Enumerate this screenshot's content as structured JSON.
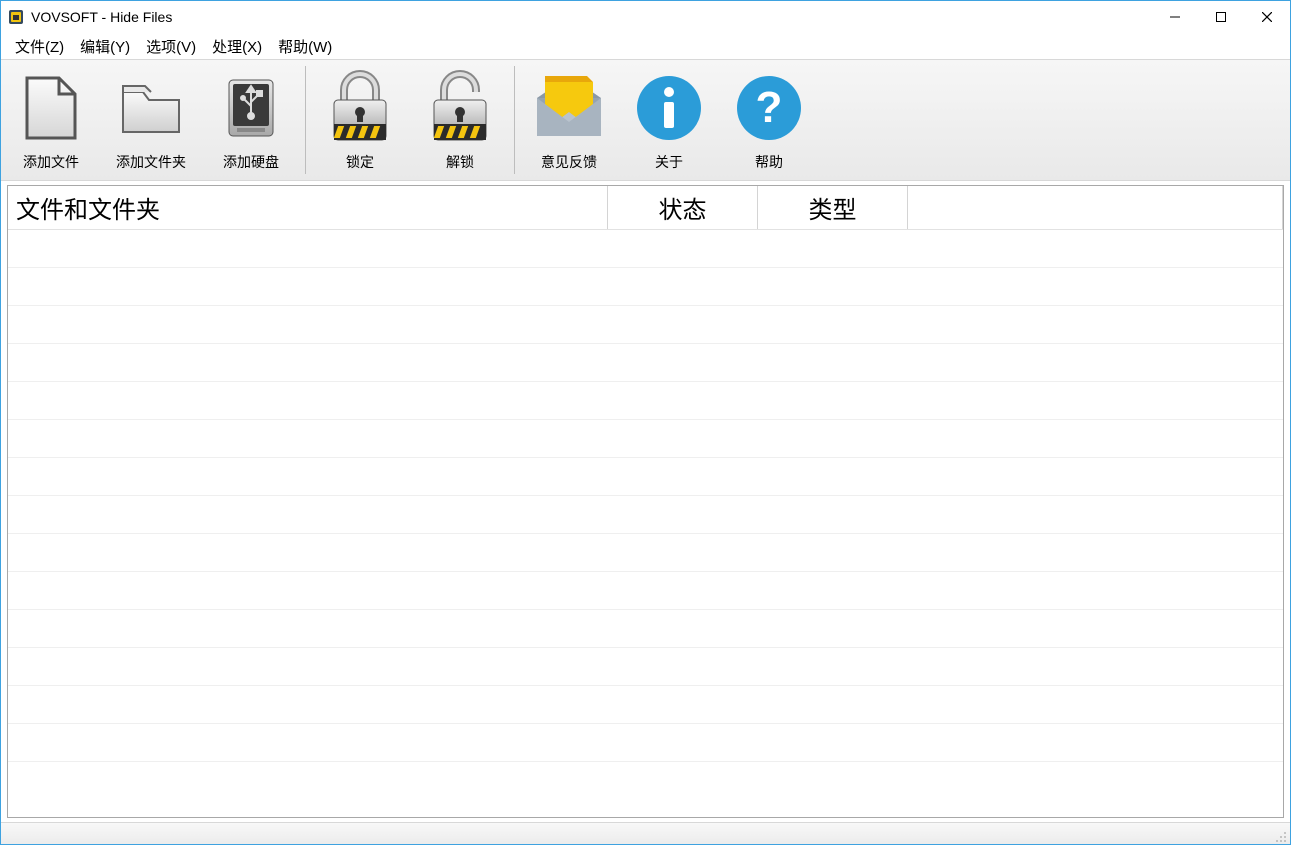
{
  "window": {
    "title": "VOVSOFT - Hide Files"
  },
  "menubar": {
    "file": "文件(Z)",
    "edit": "编辑(Y)",
    "options": "选项(V)",
    "process": "处理(X)",
    "help": "帮助(W)"
  },
  "toolbar": {
    "add_file": "添加文件",
    "add_folder": "添加文件夹",
    "add_disk": "添加硬盘",
    "lock": "锁定",
    "unlock": "解锁",
    "feedback": "意见反馈",
    "about": "关于",
    "help": "帮助"
  },
  "grid": {
    "headers": {
      "files": "文件和文件夹",
      "status": "状态",
      "type": "类型"
    },
    "rows": []
  },
  "colors": {
    "accent": "#2b9cd8",
    "border": "#3ea2e0"
  }
}
